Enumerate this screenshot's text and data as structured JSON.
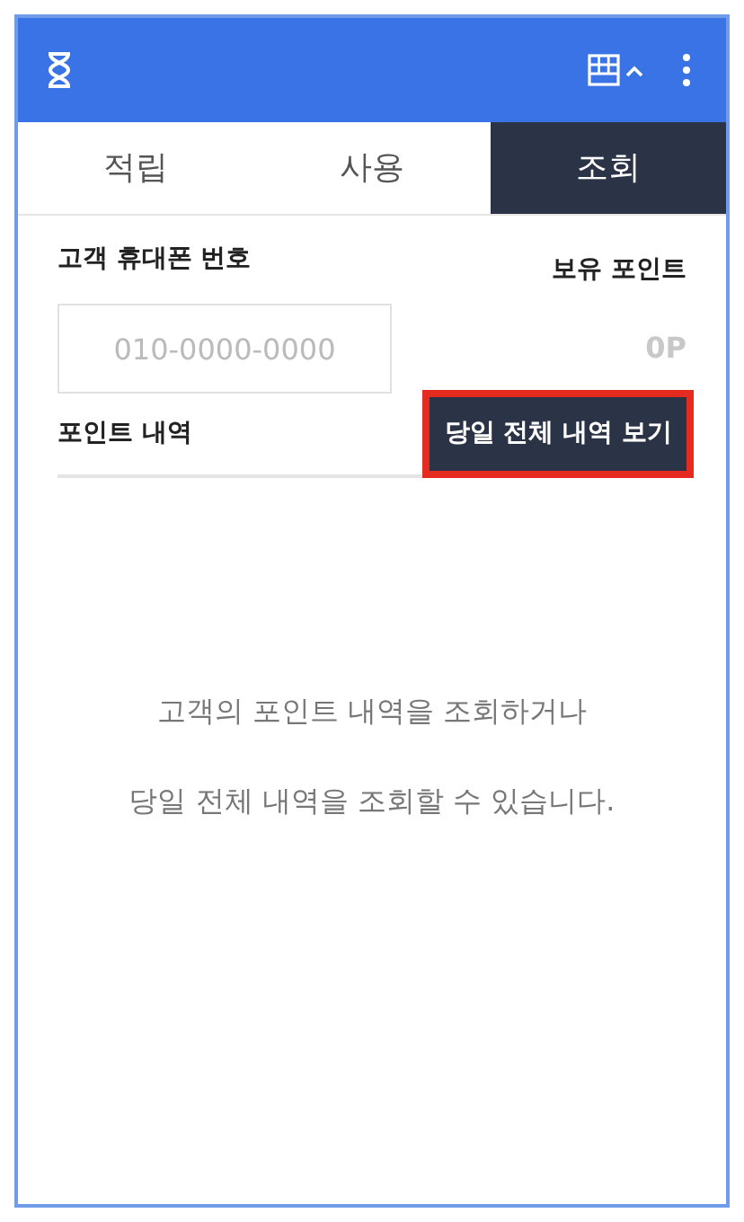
{
  "tabs": [
    {
      "label": "적립",
      "selected": false
    },
    {
      "label": "사용",
      "selected": false
    },
    {
      "label": "조회",
      "selected": true
    }
  ],
  "phone": {
    "label": "고객 휴대폰 번호",
    "placeholder": "010-0000-0000"
  },
  "points": {
    "label": "보유 포인트",
    "value": "0P"
  },
  "history": {
    "label": "포인트 내역",
    "button": {
      "label": "당일 전체 내역 보기",
      "highlighted": true
    }
  },
  "empty_message": [
    "고객의 포인트 내역을 조회하거나",
    "당일 전체 내역을 조회할 수 있습니다."
  ]
}
